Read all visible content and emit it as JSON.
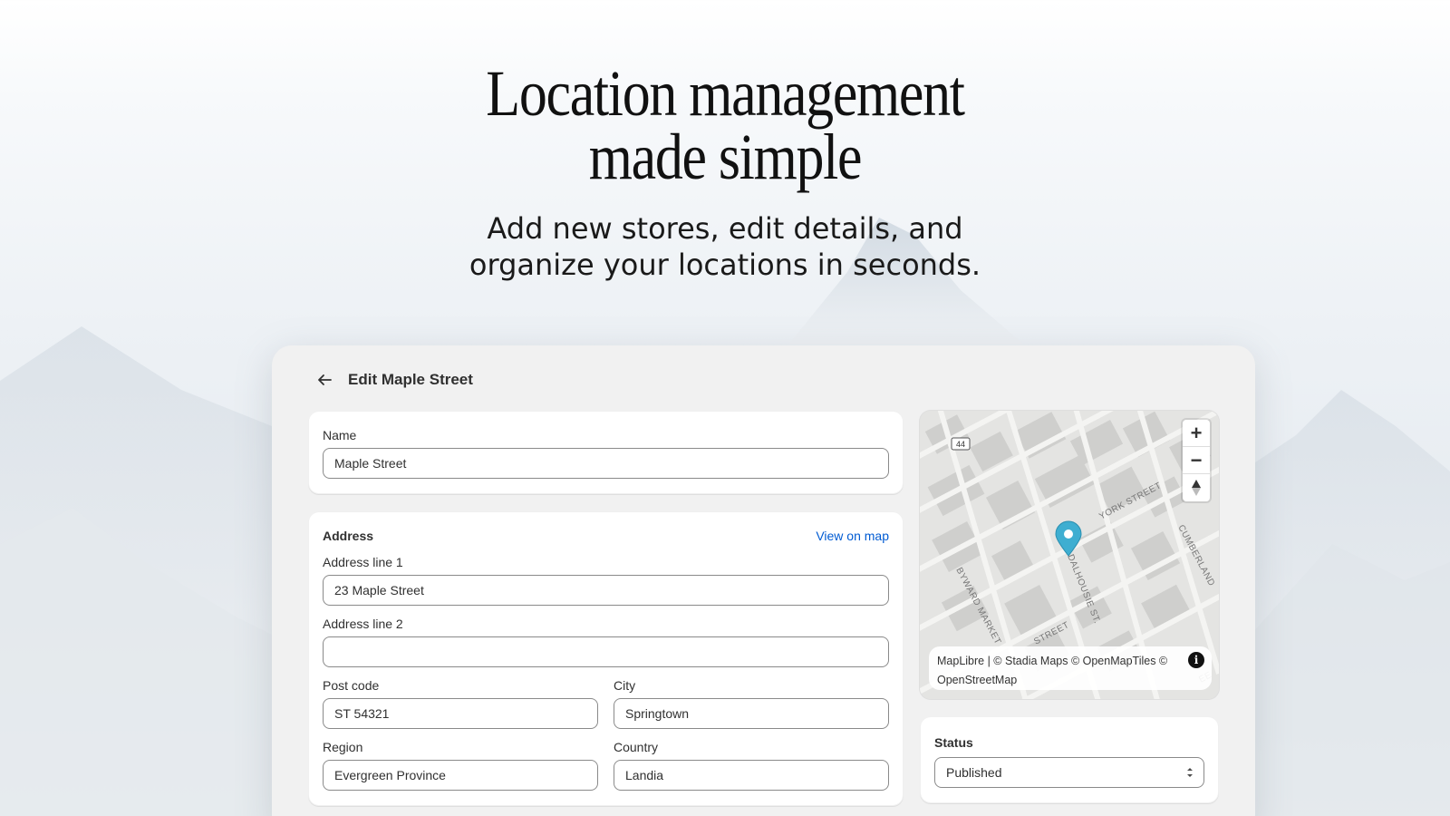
{
  "hero": {
    "title_line1": "Location management",
    "title_line2": "made simple",
    "subtitle_line1": "Add new stores, edit details, and",
    "subtitle_line2": "organize your locations in seconds."
  },
  "page": {
    "title": "Edit Maple Street"
  },
  "name_card": {
    "label": "Name",
    "value": "Maple Street"
  },
  "address_card": {
    "heading": "Address",
    "view_on_map": "View on map",
    "line1_label": "Address line 1",
    "line1_value": "23 Maple Street",
    "line2_label": "Address line 2",
    "line2_value": "",
    "postcode_label": "Post code",
    "postcode_value": "ST 54321",
    "city_label": "City",
    "city_value": "Springtown",
    "region_label": "Region",
    "region_value": "Evergreen Province",
    "country_label": "Country",
    "country_value": "Landia"
  },
  "map": {
    "route_badge": "44",
    "street_labels": [
      "YORK STREET",
      "CUMBERLAND",
      "BYWARD MARKET",
      "DALHOUSIE ST.",
      "STREET",
      "EE"
    ],
    "zoom_in": "+",
    "zoom_out": "−",
    "attribution_line1": "MapLibre | © Stadia Maps © OpenMapTiles ©",
    "attribution_line2": "OpenStreetMap",
    "info": "i",
    "marker_color": "#3eaed1"
  },
  "status_card": {
    "label": "Status",
    "value": "Published"
  },
  "colors": {
    "link": "#005bd3",
    "panel_bg": "#f1f1f1"
  }
}
